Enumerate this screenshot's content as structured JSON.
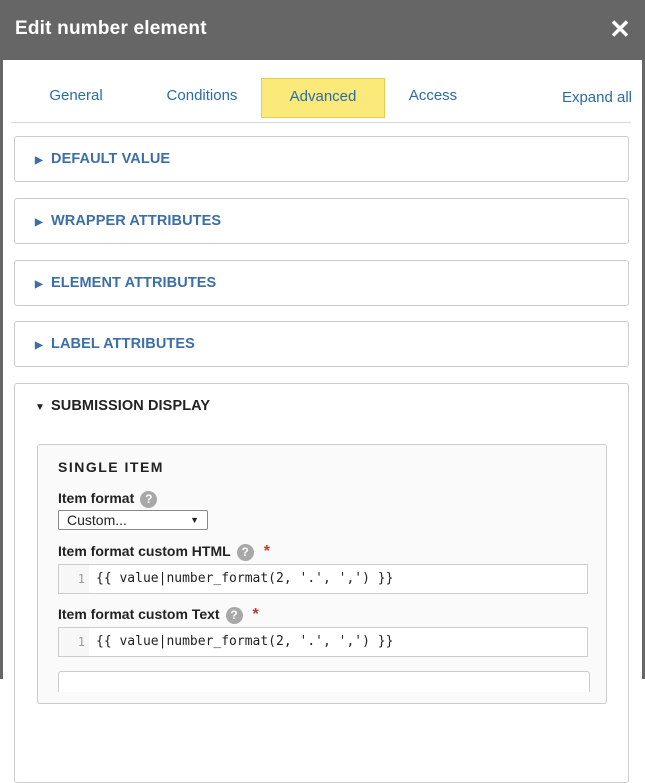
{
  "dialog": {
    "title": "Edit number element",
    "close_icon": "close-icon"
  },
  "tabs": [
    {
      "label": "General"
    },
    {
      "label": "Conditions"
    },
    {
      "label": "Advanced",
      "active": true
    },
    {
      "label": "Access"
    }
  ],
  "expand_all": "Expand all",
  "sections": [
    {
      "label": "DEFAULT VALUE"
    },
    {
      "label": "WRAPPER ATTRIBUTES"
    },
    {
      "label": "ELEMENT ATTRIBUTES"
    },
    {
      "label": "LABEL ATTRIBUTES"
    },
    {
      "label": "SUBMISSION DISPLAY"
    }
  ],
  "submission_display": {
    "single_item": {
      "title": "SINGLE ITEM",
      "item_format_label": "Item format",
      "item_format_value": "Custom...",
      "html_label": "Item format custom HTML",
      "html_line": "1",
      "html_code": "{{ value|number_format(2, '.', ',') }}",
      "text_label": "Item format custom Text",
      "text_line": "1",
      "text_code": "{{ value|number_format(2, '.', ',') }}",
      "required_mark": "*",
      "help_mark": "?"
    }
  },
  "colors": {
    "titlebar": "#666666",
    "active_tab": "#fbe97a",
    "link": "#2a6ba8",
    "required": "#c0392b"
  }
}
